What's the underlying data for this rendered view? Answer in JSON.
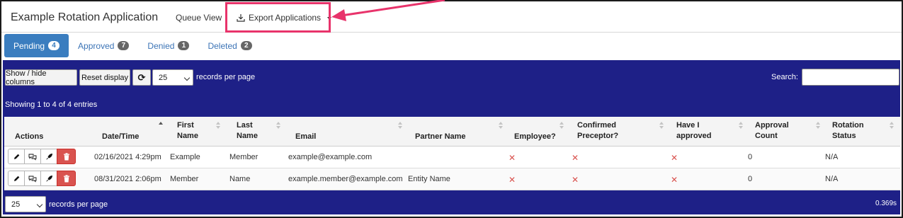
{
  "header": {
    "app_title": "Example Rotation Application",
    "queue_view": "Queue View",
    "export": "Export Applications"
  },
  "tabs": [
    {
      "label": "Pending",
      "count": "4",
      "active": true
    },
    {
      "label": "Approved",
      "count": "7",
      "active": false
    },
    {
      "label": "Denied",
      "count": "1",
      "active": false
    },
    {
      "label": "Deleted",
      "count": "2",
      "active": false
    }
  ],
  "toolbar": {
    "show_hide": "Show / hide columns",
    "reset": "Reset display",
    "page_size": "25",
    "records_per_page": "records per page",
    "search_label": "Search:",
    "search_value": ""
  },
  "info": "Showing 1 to 4 of 4 entries",
  "table": {
    "headers": {
      "actions": "Actions",
      "datetime": "Date/Time",
      "first_1": "First",
      "first_2": "Name",
      "last_1": "Last",
      "last_2": "Name",
      "email": "Email",
      "partner": "Partner Name",
      "employee": "Employee?",
      "confirmed_1": "Confirmed",
      "confirmed_2": "Preceptor?",
      "haveI_1": "Have I",
      "haveI_2": "approved",
      "approval_1": "Approval",
      "approval_2": "Count",
      "rotation_1": "Rotation",
      "rotation_2": "Status"
    },
    "rows": [
      {
        "datetime": "02/16/2021 4:29pm",
        "first": "Example",
        "last": "Member",
        "email": "example@example.com",
        "partner": "",
        "employee": "✕",
        "confirmed": "✕",
        "approved": "✕",
        "count": "0",
        "status": "N/A"
      },
      {
        "datetime": "08/31/2021 2:06pm",
        "first": "Member",
        "last": "Name",
        "email": "example.member@example.com",
        "partner": "Entity Name",
        "employee": "✕",
        "confirmed": "✕",
        "approved": "✕",
        "count": "0",
        "status": "N/A"
      }
    ]
  },
  "footer": {
    "page_size": "25",
    "records_per_page": "records per page",
    "timing": "0.369s"
  },
  "colors": {
    "panel": "#1e2087",
    "active_tab": "#3a7dbf",
    "highlight": "#e8336b",
    "delete": "#d9534f"
  },
  "icons": [
    "download-icon",
    "caret-down-icon",
    "refresh-icon",
    "pencil-icon",
    "comments-icon",
    "rocket-icon",
    "trash-icon",
    "sort-icon",
    "chevron-down-icon"
  ]
}
